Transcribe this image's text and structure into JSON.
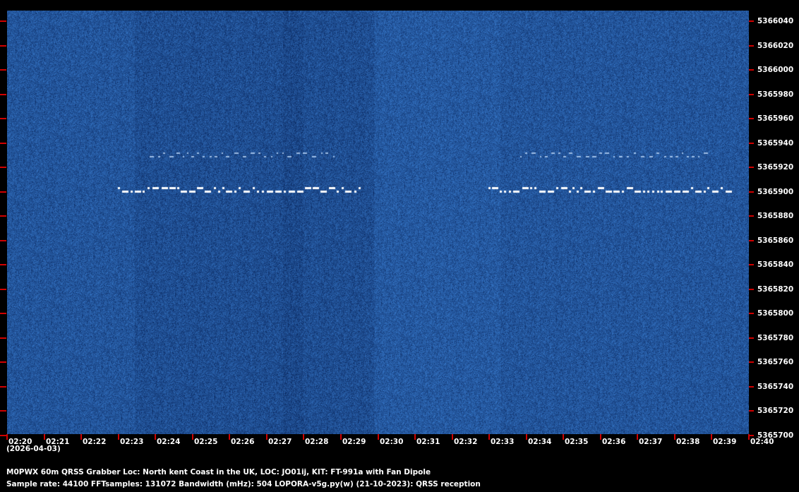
{
  "frequency_labels": [
    "5366040",
    "5366020",
    "5366000",
    "5365980",
    "5365960",
    "5365940",
    "5365920",
    "5365900",
    "5365880",
    "5365860",
    "5365840",
    "5365820",
    "5365800",
    "5365780",
    "5365760",
    "5365740",
    "5365720",
    "5365700"
  ],
  "time_labels": [
    "02:20",
    "02:21",
    "02:22",
    "02:23",
    "02:24",
    "02:25",
    "02:26",
    "02:27",
    "02:28",
    "02:29",
    "02:30",
    "02:31",
    "02:32",
    "02:33",
    "02:34",
    "02:35",
    "02:36",
    "02:37",
    "02:38",
    "02:39",
    "02:40"
  ],
  "date_label": "(2026-04-03)",
  "info": {
    "line1": "M0PWX 60m QRSS Grabber Loc: North kent Coast in the UK, LOC: JO01ij, KIT: FT-991a with Fan Dipole",
    "line2": "Sample rate: 44100     FFTsamples: 131072     Bandwidth (mHz): 504          LOPORA-v5g.py(w) (21-10-2023): QRSS reception"
  },
  "colors": {
    "background": "#000000",
    "spectrogram": "#16458c",
    "tick": "#d00000",
    "signal": "#ffffff"
  }
}
